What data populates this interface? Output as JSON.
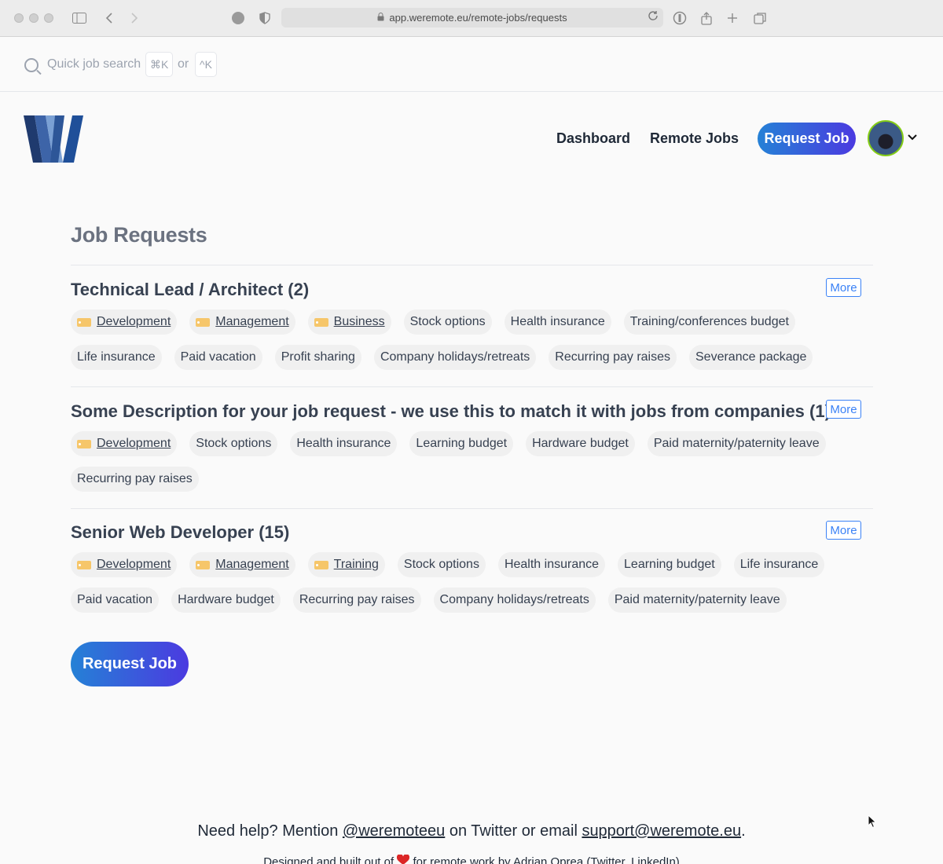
{
  "browser": {
    "url": "app.weremote.eu/remote-jobs/requests"
  },
  "search": {
    "placeholder": "Quick job search",
    "shortcut_mac": "⌘K",
    "or_text": "or",
    "shortcut_other": "^K"
  },
  "nav": {
    "dashboard": "Dashboard",
    "remote_jobs": "Remote Jobs",
    "request_job": "Request Job"
  },
  "page": {
    "title": "Job Requests"
  },
  "requests": [
    {
      "title": "Technical Lead / Architect (2)",
      "more_label": "More",
      "tags": [
        {
          "label": "Development",
          "category": true
        },
        {
          "label": "Management",
          "category": true
        },
        {
          "label": "Business",
          "category": true
        },
        {
          "label": "Stock options",
          "category": false
        },
        {
          "label": "Health insurance",
          "category": false
        },
        {
          "label": "Training/conferences budget",
          "category": false
        },
        {
          "label": "Life insurance",
          "category": false
        },
        {
          "label": "Paid vacation",
          "category": false
        },
        {
          "label": "Profit sharing",
          "category": false
        },
        {
          "label": "Company holidays/retreats",
          "category": false
        },
        {
          "label": "Recurring pay raises",
          "category": false
        },
        {
          "label": "Severance package",
          "category": false
        }
      ]
    },
    {
      "title": "Some Description for your job request - we use this to match it with jobs from companies (1)",
      "more_label": "More",
      "tags": [
        {
          "label": "Development",
          "category": true
        },
        {
          "label": "Stock options",
          "category": false
        },
        {
          "label": "Health insurance",
          "category": false
        },
        {
          "label": "Learning budget",
          "category": false
        },
        {
          "label": "Hardware budget",
          "category": false
        },
        {
          "label": "Paid maternity/paternity leave",
          "category": false
        },
        {
          "label": "Recurring pay raises",
          "category": false
        }
      ]
    },
    {
      "title": "Senior Web Developer (15)",
      "more_label": "More",
      "tags": [
        {
          "label": "Development",
          "category": true
        },
        {
          "label": "Management",
          "category": true
        },
        {
          "label": "Training",
          "category": true
        },
        {
          "label": "Stock options",
          "category": false
        },
        {
          "label": "Health insurance",
          "category": false
        },
        {
          "label": "Learning budget",
          "category": false
        },
        {
          "label": "Life insurance",
          "category": false
        },
        {
          "label": "Paid vacation",
          "category": false
        },
        {
          "label": "Hardware budget",
          "category": false
        },
        {
          "label": "Recurring pay raises",
          "category": false
        },
        {
          "label": "Company holidays/retreats",
          "category": false
        },
        {
          "label": "Paid maternity/paternity leave",
          "category": false
        }
      ]
    }
  ],
  "main_button": "Request Job",
  "footer": {
    "help_prefix": "Need help? Mention ",
    "twitter_handle": "@weremoteeu",
    "help_middle": " on Twitter or email ",
    "support_email": "support@weremote.eu",
    "help_suffix": ".",
    "credit_prefix": "Designed and built out of ",
    "credit_suffix": " for remote work by Adrian Oprea (Twitter, LinkedIn)"
  },
  "colors": {
    "accent_gradient_start": "#2581d6",
    "accent_gradient_end": "#4b3ae0",
    "more_button": "#3b82f6",
    "tag_bg": "#f0f0f0"
  }
}
